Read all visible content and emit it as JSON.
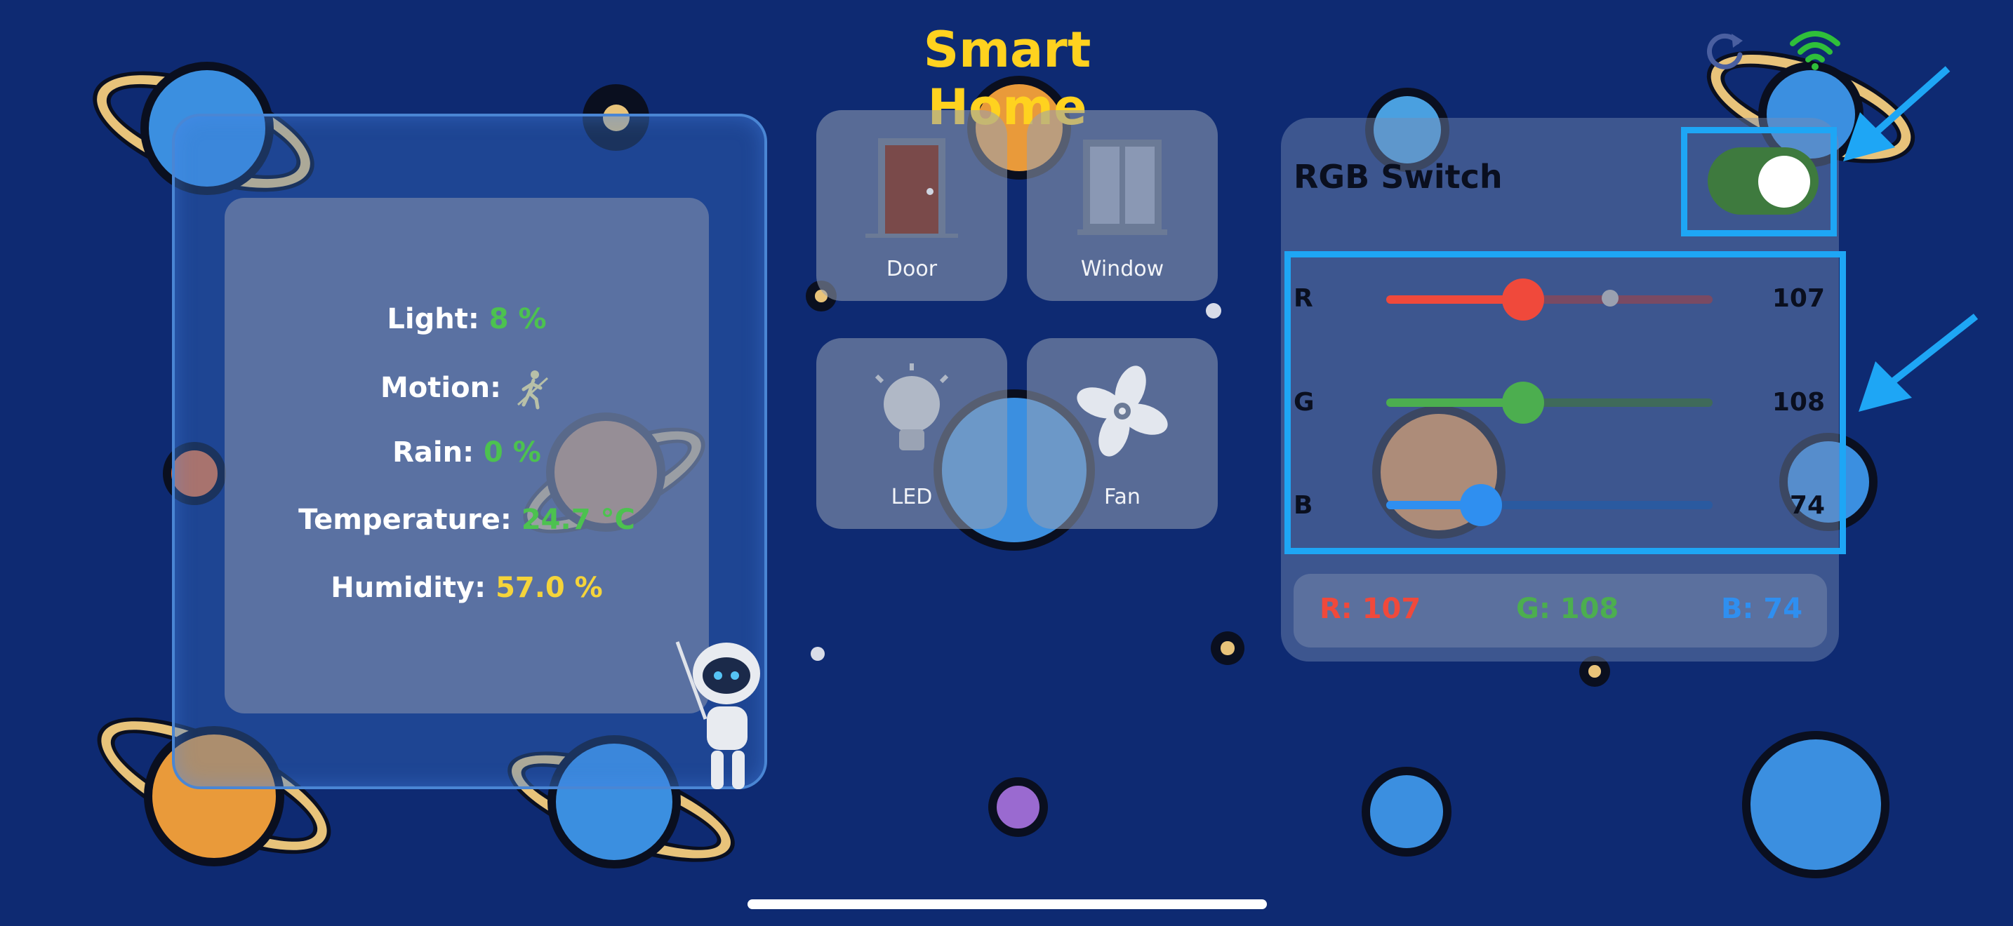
{
  "header": {
    "title": "Smart Home",
    "refresh_icon": "refresh-icon",
    "wifi_icon": "wifi-icon"
  },
  "sensors": {
    "light": {
      "label": "Light:",
      "value": "8 %"
    },
    "motion": {
      "label": "Motion:",
      "icon": "walking-person-icon"
    },
    "rain": {
      "label": "Rain:",
      "value": "0 %"
    },
    "temperature": {
      "label": "Temperature:",
      "value": "24.7 °C"
    },
    "humidity": {
      "label": "Humidity:",
      "value": "57.0 %"
    }
  },
  "devices": [
    {
      "label": "Door",
      "icon": "door-icon"
    },
    {
      "label": "Window",
      "icon": "window-icon"
    },
    {
      "label": "LED",
      "icon": "bulb-icon"
    },
    {
      "label": "Fan",
      "icon": "fan-icon"
    }
  ],
  "rgb": {
    "title": "RGB Switch",
    "switch_on": true,
    "channels": [
      {
        "label": "R",
        "value": "107",
        "level": 0.42,
        "color": "#f0493b"
      },
      {
        "label": "G",
        "value": "108",
        "level": 0.42,
        "color": "#4cae4f"
      },
      {
        "label": "B",
        "value": "74",
        "level": 0.29,
        "color": "#2f8ff0"
      }
    ],
    "readout": {
      "r": "R: 107",
      "g": "G: 108",
      "b": "B: 74"
    }
  },
  "colors": {
    "background": "#0e2a72",
    "title": "#ffd21f",
    "highlight": "#1ea6f5",
    "wifi": "#2fbf3a"
  }
}
